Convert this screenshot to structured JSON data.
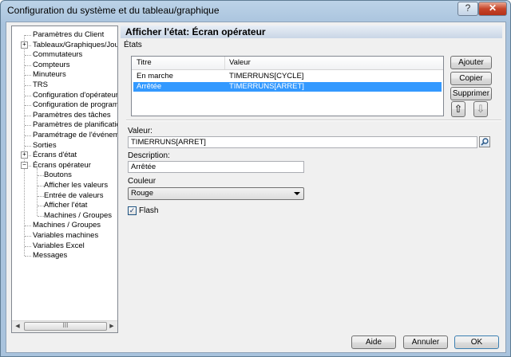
{
  "window": {
    "title": "Configuration du système et du tableau/graphique",
    "help_label": "?",
    "close_label": "✕"
  },
  "tree": {
    "items": [
      {
        "label": "Paramètres du Client"
      },
      {
        "label": "Tableaux/Graphiques/Journa",
        "expander": "+"
      },
      {
        "label": "Commutateurs"
      },
      {
        "label": "Compteurs"
      },
      {
        "label": "Minuteurs"
      },
      {
        "label": "TRS"
      },
      {
        "label": "Configuration d'opérateur"
      },
      {
        "label": "Configuration de programme"
      },
      {
        "label": "Paramètres des tâches"
      },
      {
        "label": "Paramètres de planification"
      },
      {
        "label": "Paramétrage de l'événement"
      },
      {
        "label": "Sorties"
      },
      {
        "label": "Écrans d'état",
        "expander": "+"
      },
      {
        "label": "Écrans opérateur",
        "expander": "−"
      },
      {
        "label": "Boutons",
        "child": true
      },
      {
        "label": "Afficher les valeurs",
        "child": true
      },
      {
        "label": "Entrée de valeurs",
        "child": true
      },
      {
        "label": "Afficher l'état",
        "child": true,
        "current": true
      },
      {
        "label": "Machines / Groupes",
        "child": true
      },
      {
        "label": "Machines / Groupes"
      },
      {
        "label": "Variables machines"
      },
      {
        "label": "Variables Excel"
      },
      {
        "label": "Messages"
      }
    ],
    "scroll_left": "◀",
    "scroll_right": "▶",
    "scroll_grip": "III"
  },
  "panel": {
    "header": "Afficher l'état: Écran opérateur",
    "states_label": "États",
    "columns": [
      "Titre",
      "Valeur"
    ],
    "rows": [
      {
        "titre": "En marche",
        "valeur": "TIMERRUNS[CYCLE]",
        "selected": false
      },
      {
        "titre": "Arrêtée",
        "valeur": "TIMERRUNS[ARRET]",
        "selected": true
      }
    ],
    "buttons": {
      "add": "Ajouter",
      "copy": "Copier",
      "delete": "Supprimer",
      "up": "⇧",
      "down": "⇩"
    },
    "value_label": "Valeur:",
    "value": "TIMERRUNS[ARRET]",
    "description_label": "Description:",
    "description": "Arrêtée",
    "color_label": "Couleur",
    "color_value": "Rouge",
    "flash_label": "Flash",
    "flash_checked": true,
    "check_mark": "✓"
  },
  "footer": {
    "help": "Aide",
    "cancel": "Annuler",
    "ok": "OK"
  },
  "colors": {
    "selection": "#3399ff",
    "title_gradient": "#bcd3e8",
    "close_button": "#c7452a"
  }
}
